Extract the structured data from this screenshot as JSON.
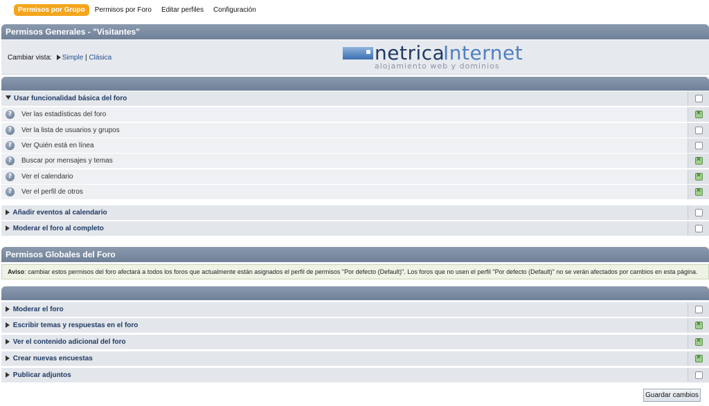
{
  "nav": {
    "tabs": [
      {
        "label": "Permisos por Grupo",
        "active": true
      },
      {
        "label": "Permisos por Foro",
        "active": false
      },
      {
        "label": "Editar perfiles",
        "active": false
      },
      {
        "label": "Configuración",
        "active": false
      }
    ]
  },
  "general": {
    "title": "Permisos Generales - \"Visitantes\"",
    "view_prefix": "Cambiar vista:",
    "view_simple": "Simple",
    "view_separator": "|",
    "view_classic": "Clásica"
  },
  "logo": {
    "name_part1": "netrica",
    "name_part2": "Internet",
    "tagline": "alojamiento web y dominios"
  },
  "basic_group": {
    "label": "Usar funcionalidad básica del foro",
    "checked": false,
    "items": [
      {
        "label": "Ver las estadísticas del foro",
        "checked": true
      },
      {
        "label": "Ver la lista de usuarios y grupos",
        "checked": false
      },
      {
        "label": "Ver Quién está en línea",
        "checked": false
      },
      {
        "label": "Buscar por mensajes y temas",
        "checked": true
      },
      {
        "label": "Ver el calendario",
        "checked": true
      },
      {
        "label": "Ver el perfil de otros",
        "checked": true
      }
    ]
  },
  "other_groups": [
    {
      "label": "Añadir eventos al calendario",
      "checked": false
    },
    {
      "label": "Moderar el foro al completo",
      "checked": false
    }
  ],
  "global": {
    "title": "Permisos Globales del Foro",
    "notice_bold": "Aviso",
    "notice_text": ": cambiar estos permisos del foro afectará a todos los foros que actualmente están asignados el perfil de permisos \"Por defecto (Default)\". Los foros que no usen el perfil \"Por defecto (Default)\" no se verán afectados por cambios en esta página.",
    "groups": [
      {
        "label": "Moderar el foro",
        "checked": false
      },
      {
        "label": "Escribir temas y respuestas en el foro",
        "checked": true
      },
      {
        "label": "Ver el contenido adicional del foro",
        "checked": true
      },
      {
        "label": "Crear nuevas encuestas",
        "checked": true
      },
      {
        "label": "Publicar adjuntos",
        "checked": false
      }
    ]
  },
  "save_label": "Guardar cambios",
  "colors": {
    "active_tab": "#f4a51c",
    "header": "#7a8aa0",
    "checked": "#9fd08c"
  }
}
